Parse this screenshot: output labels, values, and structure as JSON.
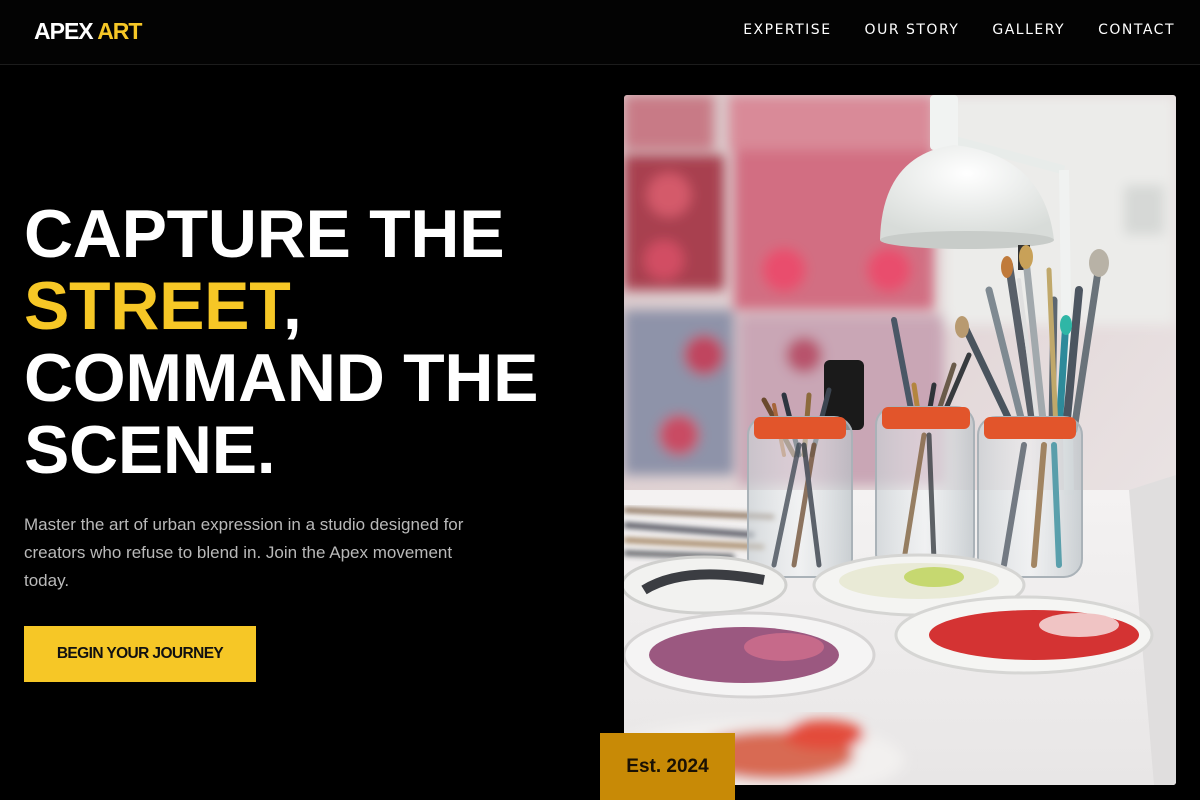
{
  "brand": {
    "name_part1": "APEX",
    "name_part2": "ART"
  },
  "nav": {
    "items": [
      {
        "label": "EXPERTISE"
      },
      {
        "label": "OUR STORY"
      },
      {
        "label": "GALLERY"
      },
      {
        "label": "CONTACT"
      }
    ]
  },
  "hero": {
    "line1": "CAPTURE THE",
    "line2_highlight": "STREET",
    "line2_rest": ",",
    "line3": "COMMAND THE",
    "line4": "SCENE.",
    "description": "Master the art of urban expression in a studio designed for creators who refuse to blend in. Join the Apex movement today.",
    "cta_label": "BEGIN YOUR JOURNEY"
  },
  "badge": {
    "label": "Est. 2024"
  },
  "colors": {
    "accent": "#f6c726",
    "badge": "#c88a06",
    "background": "#000000"
  }
}
